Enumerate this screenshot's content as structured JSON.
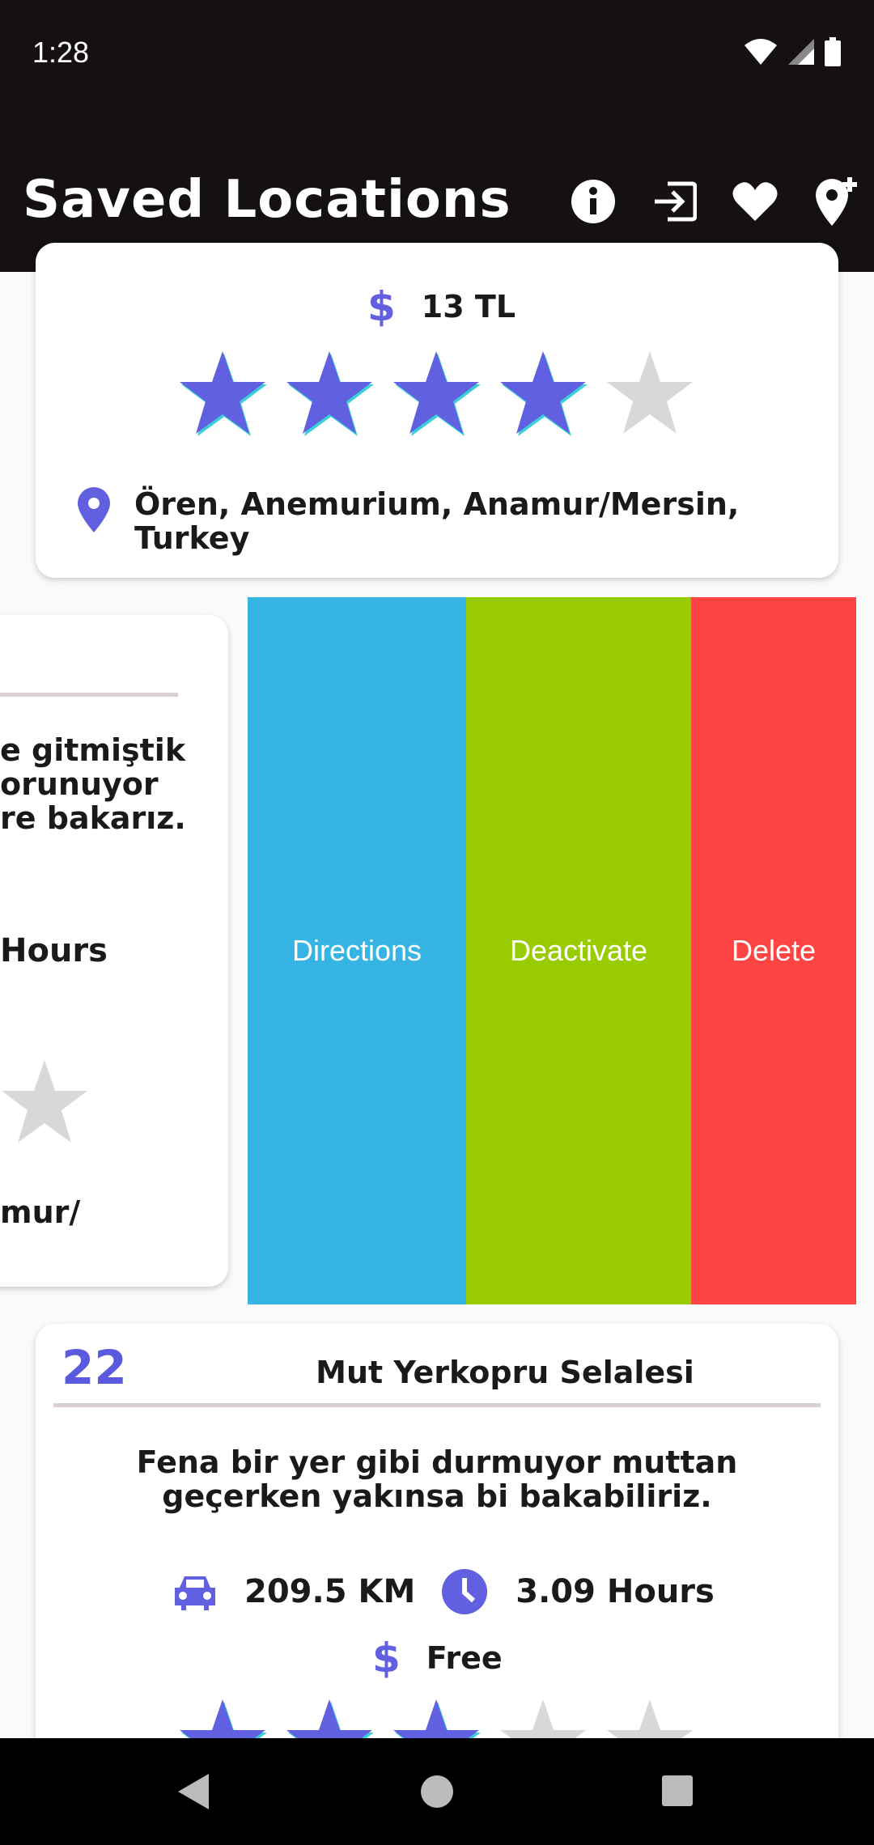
{
  "status": {
    "time": "1:28"
  },
  "appbar": {
    "title": "Saved Locations",
    "icons": [
      "info-icon",
      "exit-icon",
      "heart-icon",
      "add-location-icon"
    ]
  },
  "card1": {
    "price": "13 TL",
    "rating": 4,
    "max_rating": 5,
    "location_line1": "Ören, Anemurium, Anamur/Mersin,",
    "location_line2": "Turkey"
  },
  "card2_partial": {
    "desc_line1": "e gitmiştik",
    "desc_line2": "orunuyor",
    "desc_line3": "re bakarız.",
    "duration": "Hours",
    "location_fragment": "mur/"
  },
  "swipe_actions": {
    "directions": "Directions",
    "deactivate": "Deactivate",
    "delete": "Delete"
  },
  "card3": {
    "number": "22",
    "title": "Mut Yerkopru Selalesi",
    "desc_line1": "Fena bir yer gibi durmuyor muttan",
    "desc_line2": "geçerken yakınsa bi bakabiliriz.",
    "distance": "209.5 KM",
    "duration": "3.09 Hours",
    "price": "Free",
    "rating": 3,
    "max_rating": 5
  },
  "colors": {
    "accent": "#6060e0",
    "directions": "#36b5e5",
    "deactivate": "#99cc00",
    "delete": "#ff4444",
    "star_empty": "#d8d8d8"
  }
}
